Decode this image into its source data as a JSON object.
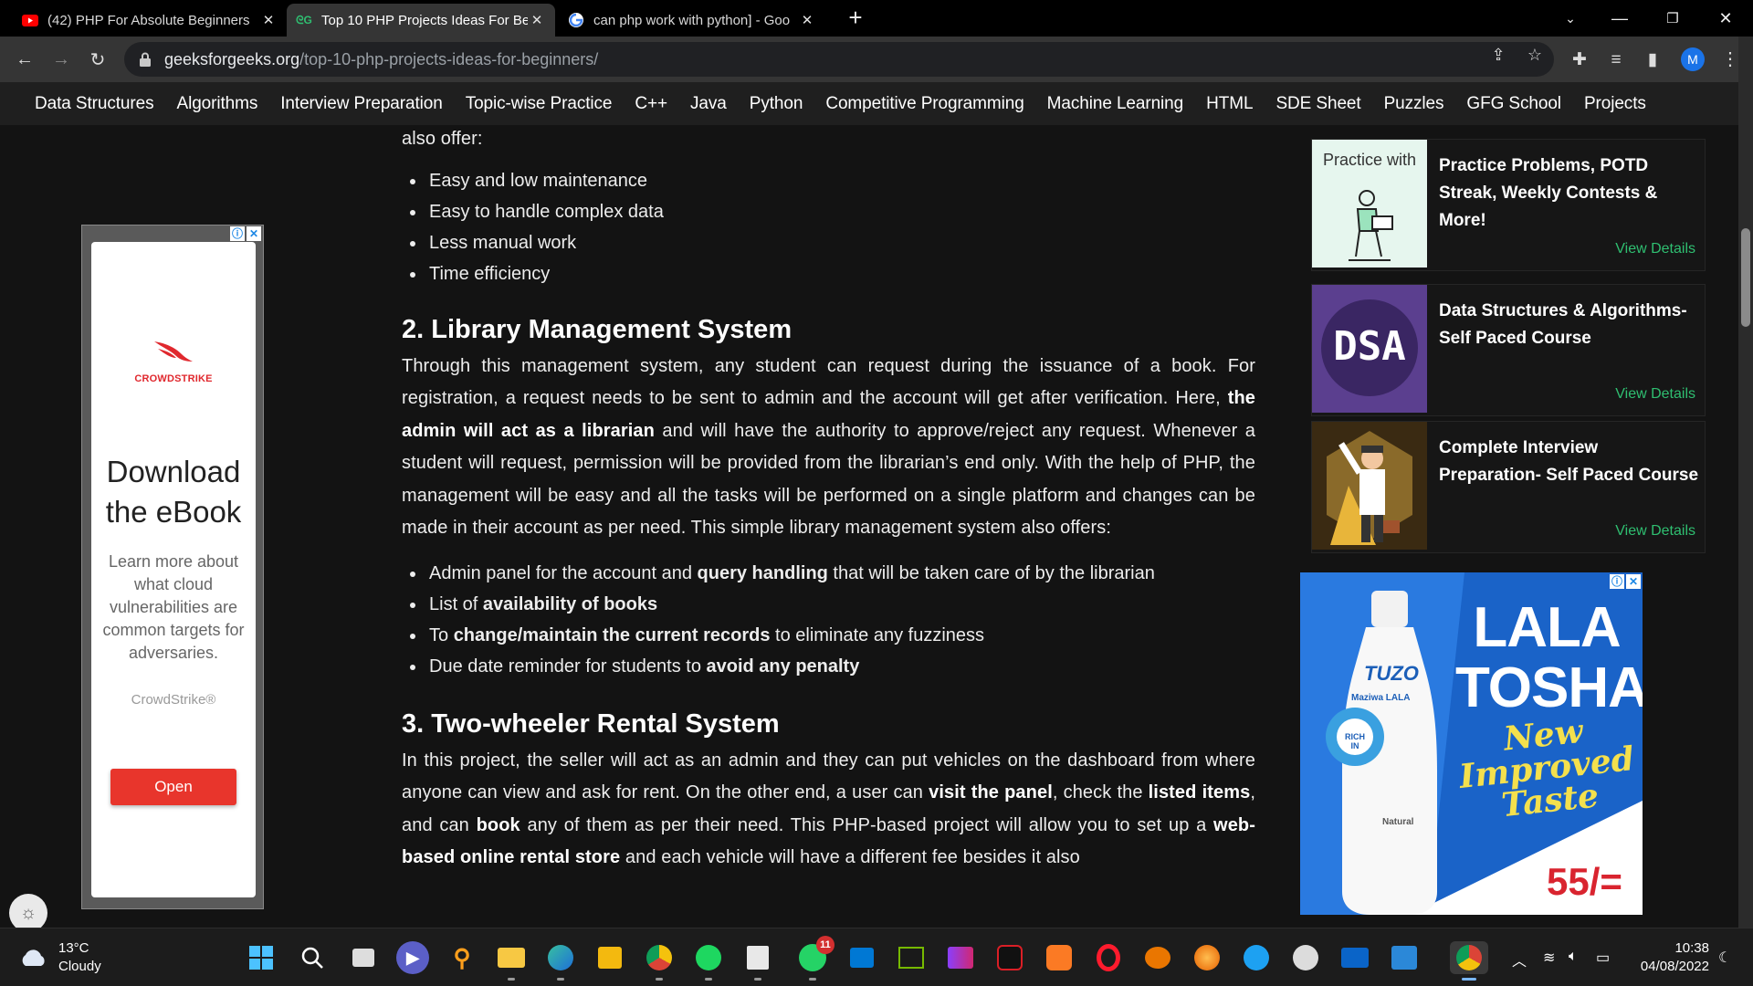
{
  "browser": {
    "tabs": [
      {
        "title": "(42) PHP For Absolute Beginners",
        "icon": "youtube-icon"
      },
      {
        "title": "Top 10 PHP Projects Ideas For Be",
        "icon": "gfg-icon"
      },
      {
        "title": "can php work with python] - Goo",
        "icon": "google-icon"
      }
    ],
    "url_host": "geeksforgeeks.org",
    "url_path": "/top-10-php-projects-ideas-for-beginners/",
    "profile_initial": "M"
  },
  "nav": {
    "items": [
      "Data Structures",
      "Algorithms",
      "Interview Preparation",
      "Topic-wise Practice",
      "C++",
      "Java",
      "Python",
      "Competitive Programming",
      "Machine Learning",
      "HTML",
      "SDE Sheet",
      "Puzzles",
      "GFG School",
      "Projects"
    ]
  },
  "article": {
    "intro_tail": "also offer:",
    "list1": [
      "Easy and low maintenance",
      "Easy to handle complex data",
      "Less manual work",
      "Time efficiency"
    ],
    "h2": "2. Library Management System",
    "p2": {
      "a": "Through this management system, any student can request during the issuance of a book. For registration, a request needs to be sent to admin and the account will get after verification. Here, ",
      "b": "the admin will act as a librarian",
      "c": " and will have the authority to approve/reject any request. Whenever a student will request, permission will be provided from the librarian’s end only. With the help of PHP, the management will be easy and all the tasks will be performed on a single platform and changes can be made in their account as per need. This simple library management system also offers:"
    },
    "list2": [
      {
        "pre": "Admin panel for the account and ",
        "bold": "query handling",
        "post": " that will be taken care of by the librarian"
      },
      {
        "pre": "List of ",
        "bold": "availability of books",
        "post": ""
      },
      {
        "pre": "To ",
        "bold": "change/maintain the current records",
        "post": " to eliminate any fuzziness"
      },
      {
        "pre": "Due date reminder for students to ",
        "bold": "avoid any penalty",
        "post": ""
      }
    ],
    "h3": "3. Two-wheeler Rental System",
    "p3": {
      "a": "In this project, the seller will act as an admin and they can put vehicles on the dashboard from where anyone can view and ask for rent. On the other end, a user can ",
      "b": "visit the panel",
      "c": ", check the ",
      "d": "listed items",
      "e": ", and can ",
      "f": "book",
      "g": " any of them as per their need. This PHP-based project will allow you to set up a ",
      "h": "web-based online rental store",
      "i": " and each vehicle will have a different fee besides it also"
    }
  },
  "left_ad": {
    "brand_logo_text": "CROWDSTRIKE",
    "headline": "Download the eBook",
    "body": "Learn more about what cloud vulnerabilities are common targets for adversaries.",
    "brand": "CrowdStrike®",
    "cta": "Open"
  },
  "sidebar": {
    "cards": [
      {
        "thumb_text": "Practice with",
        "title": "Practice Problems, POTD Streak, Weekly Contests & More!",
        "link": "View Details"
      },
      {
        "thumb_text": "DSA",
        "title": "Data Structures & Algorithms- Self Paced Course",
        "link": "View Details"
      },
      {
        "thumb_text": "",
        "title": "Complete Interview Preparation- Self Paced Course",
        "link": "View Details"
      }
    ]
  },
  "right_ad": {
    "headline": "LALA TOSHA",
    "tagline": "New Improved Taste",
    "price": "55/=",
    "bottle_brand": "TUZO",
    "bottle_sub": "Maziwa LALA",
    "bottle_badge": "RICH IN",
    "bottle_natural": "Natural"
  },
  "taskbar": {
    "weather_temp": "13°C",
    "weather_desc": "Cloudy",
    "whatsapp_badge": "11",
    "time": "10:38",
    "date": "04/08/2022"
  },
  "colors": {
    "accent_green": "#2fbf71",
    "page_bg": "#131313"
  }
}
